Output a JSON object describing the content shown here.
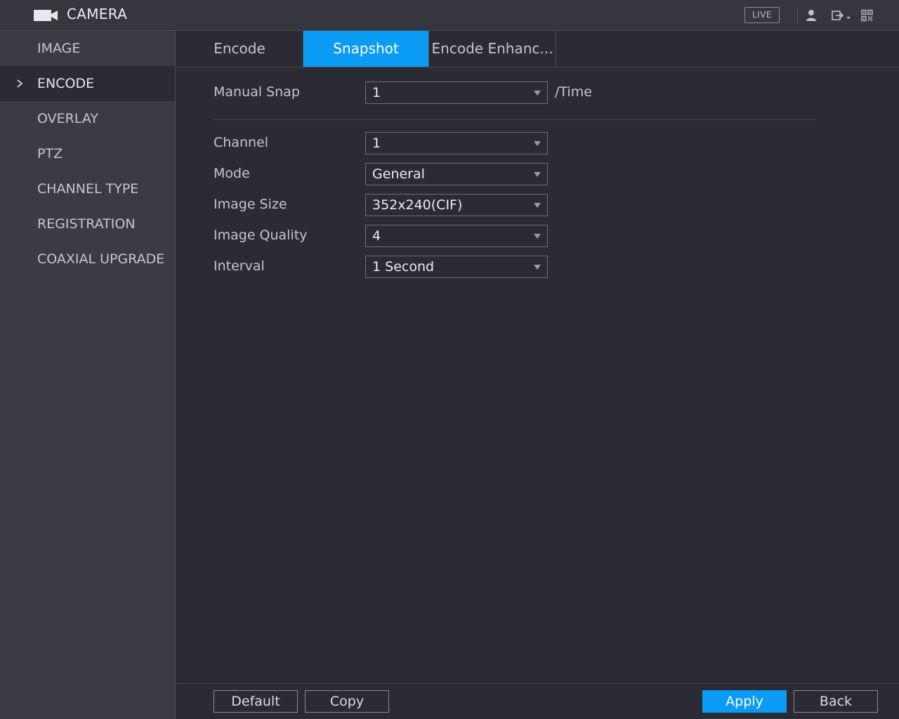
{
  "header": {
    "title": "CAMERA",
    "live_label": "LIVE",
    "icons": [
      "camera-icon",
      "user-icon",
      "logout-icon",
      "qr-code-icon"
    ]
  },
  "sidebar": {
    "items": [
      {
        "label": "IMAGE"
      },
      {
        "label": "ENCODE",
        "active": true
      },
      {
        "label": "OVERLAY"
      },
      {
        "label": "PTZ"
      },
      {
        "label": "CHANNEL TYPE"
      },
      {
        "label": "REGISTRATION"
      },
      {
        "label": "COAXIAL UPGRADE"
      }
    ]
  },
  "tabs": [
    {
      "label": "Encode"
    },
    {
      "label": "Snapshot",
      "active": true
    },
    {
      "label": "Encode Enhanc..."
    }
  ],
  "form": {
    "manual_snap": {
      "label": "Manual Snap",
      "value": "1",
      "suffix": "/Time"
    },
    "channel": {
      "label": "Channel",
      "value": "1"
    },
    "mode": {
      "label": "Mode",
      "value": "General"
    },
    "image_size": {
      "label": "Image Size",
      "value": "352x240(CIF)"
    },
    "image_quality": {
      "label": "Image Quality",
      "value": "4"
    },
    "interval": {
      "label": "Interval",
      "value": "1 Second"
    }
  },
  "footer": {
    "default_label": "Default",
    "copy_label": "Copy",
    "apply_label": "Apply",
    "back_label": "Back"
  },
  "colors": {
    "accent": "#0a9bf5",
    "background": "#2a2b33",
    "sidebar": "#3a3b43"
  }
}
